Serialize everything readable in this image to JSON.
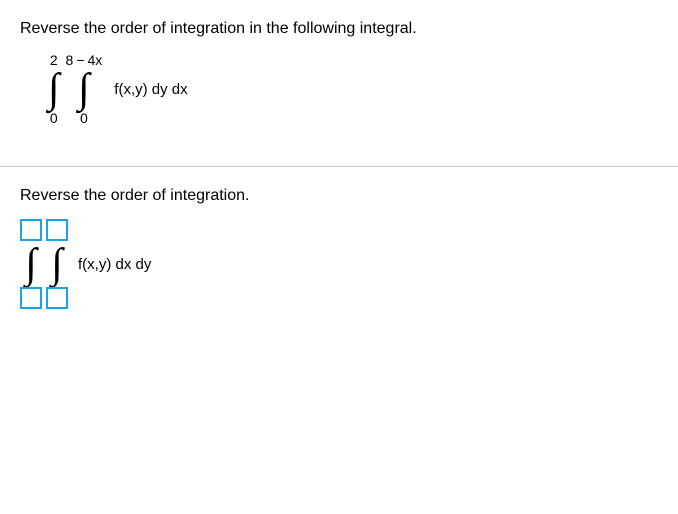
{
  "question": {
    "prompt": "Reverse the order of integration in the following integral.",
    "outer_lower": "0",
    "outer_upper": "2",
    "inner_lower": "0",
    "inner_upper_a": "8",
    "inner_upper_op": "−",
    "inner_upper_b": "4x",
    "integrand": "f(x,y) dy dx"
  },
  "answer": {
    "prompt": "Reverse the order of integration.",
    "integrand": "f(x,y) dx dy"
  },
  "chart_data": {
    "type": "table",
    "title": "Double integral order reversal",
    "given": {
      "outer_variable": "x",
      "outer_limits": [
        0,
        2
      ],
      "inner_variable": "y",
      "inner_limits": [
        "0",
        "8 - 4x"
      ],
      "integrand": "f(x,y)",
      "order": "dy dx"
    },
    "answer_template": {
      "outer_variable": "y",
      "outer_limits": [
        "□",
        "□"
      ],
      "inner_variable": "x",
      "inner_limits": [
        "□",
        "□"
      ],
      "integrand": "f(x,y)",
      "order": "dx dy"
    }
  }
}
